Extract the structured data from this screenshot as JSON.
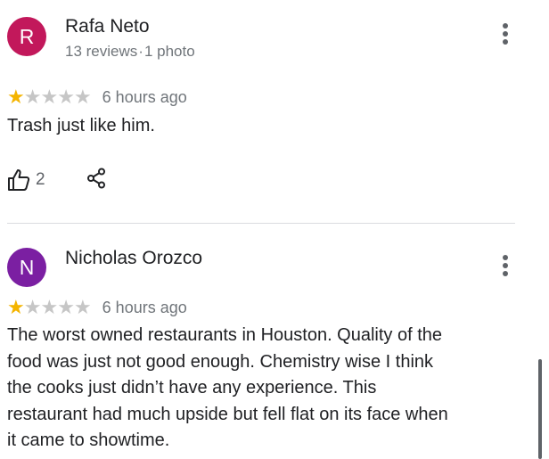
{
  "reviews": [
    {
      "avatar_letter": "R",
      "avatar_color": "#c2185b",
      "name": "Rafa Neto",
      "reviews_count": "13 reviews",
      "photos_count": "1 photo",
      "meta_separator": "·",
      "rating": 1,
      "max_rating": 5,
      "time": "6 hours ago",
      "text": "Trash just like him.",
      "likes": "2",
      "icons": [
        "thumbs-up-icon",
        "share-icon",
        "more-vert-icon"
      ]
    },
    {
      "avatar_letter": "N",
      "avatar_color": "#7b1fa2",
      "name": "Nicholas Orozco",
      "rating": 1,
      "max_rating": 5,
      "time": "6 hours ago",
      "text_lines": [
        "The worst owned restaurants in Houston. Quality of the",
        "food was just not good enough. Chemistry wise I think",
        "the cooks just didn’t have any experience. This",
        "restaurant had much upside but fell flat on its face when",
        "it came to showtime."
      ],
      "icons": [
        "more-vert-icon"
      ]
    }
  ],
  "colors": {
    "star_filled": "#f4b400",
    "star_empty": "#c6c6c6",
    "secondary_text": "#70757a",
    "divider": "#dadce0"
  }
}
